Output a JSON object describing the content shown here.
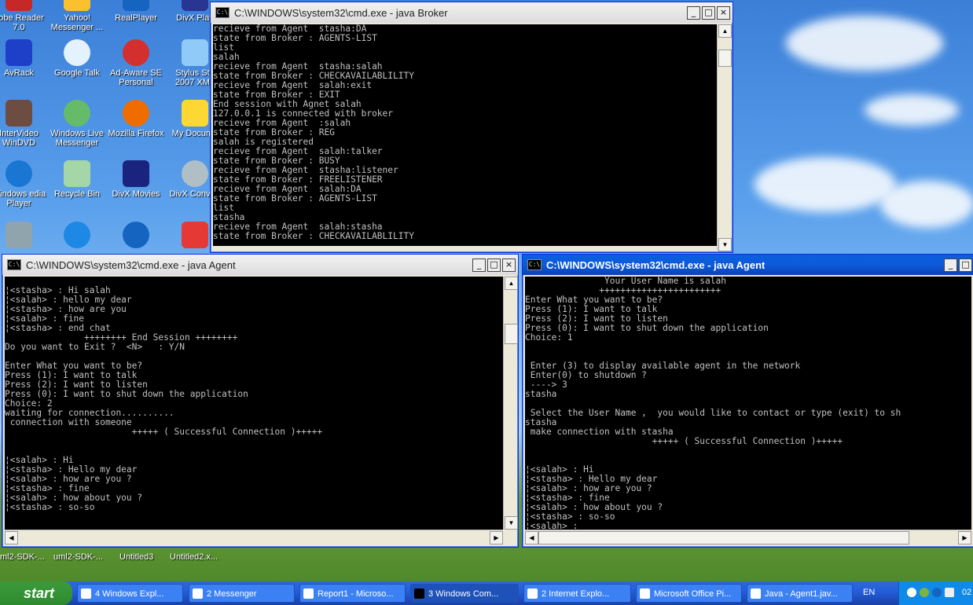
{
  "desktop": {
    "icons": [
      {
        "label": "dobe Reader 7.0"
      },
      {
        "label": "Yahoo! Messenger ..."
      },
      {
        "label": "RealPlayer"
      },
      {
        "label": "DivX Play"
      },
      {
        "label": "AvRack"
      },
      {
        "label": "Google Talk"
      },
      {
        "label": "Ad-Aware SE Personal"
      },
      {
        "label": "Stylus Stu 2007 XML"
      },
      {
        "label": "InterVideo WinDVD"
      },
      {
        "label": "Windows Live Messenger"
      },
      {
        "label": "Mozilla Firefox"
      },
      {
        "label": "My Docume"
      },
      {
        "label": "Windows edia Player"
      },
      {
        "label": "Recycle Bin"
      },
      {
        "label": "DivX Movies"
      },
      {
        "label": "DivX Convert"
      }
    ],
    "quicklaunch": [
      "ml2-SDK-...",
      "uml2-SDK-...",
      "Untitled3",
      "Untitled2.x..."
    ]
  },
  "windows": {
    "broker": {
      "title": "C:\\WINDOWS\\system32\\cmd.exe - java Broker",
      "lines": [
        "recieve from Agent  stasha:DA",
        "state from Broker : AGENTS-LIST",
        "list",
        "salah",
        "recieve from Agent  stasha:salah",
        "state from Broker : CHECKAVAILABLILITY",
        "recieve from Agent  salah:exit",
        "state from Broker : EXIT",
        "End session with Agnet salah",
        "127.0.0.1 is connected with broker",
        "recieve from Agent  :salah",
        "state from Broker : REG",
        "salah is registered",
        "recieve from Agent  salah:talker",
        "state from Broker : BUSY",
        "recieve from Agent  stasha:listener",
        "state from Broker : FREELISTENER",
        "recieve from Agent  salah:DA",
        "state from Broker : AGENTS-LIST",
        "list",
        "stasha",
        "recieve from Agent  salah:stasha",
        "state from Broker : CHECKAVAILABLILITY"
      ]
    },
    "agent_left": {
      "title": "C:\\WINDOWS\\system32\\cmd.exe - java Agent",
      "lines": [
        "",
        "¦<stasha> : Hi salah",
        "¦<salah> : hello my dear",
        "¦<stasha> : how are you",
        "¦<salah> : fine",
        "¦<stasha> : end chat",
        "               ++++++++ End Session ++++++++",
        "Do you want to Exit ?  <N>   : Y/N",
        "",
        "Enter What you want to be?",
        "Press (1): I want to talk",
        "Press (2): I want to listen",
        "Press (0): I want to shut down the application",
        "Choice: 2",
        "waiting for connection..........",
        " connection with someone",
        "                        +++++ ( Successful Connection )+++++",
        "",
        "",
        "¦<salah> : Hi",
        "¦<stasha> : Hello my dear",
        "¦<salah> : how are you ?",
        "¦<stasha> : fine",
        "¦<salah> : how about you ?",
        "¦<stasha> : so-so"
      ]
    },
    "agent_right": {
      "title": "C:\\WINDOWS\\system32\\cmd.exe - java Agent",
      "lines": [
        "               Your User Name is salah",
        "              +++++++++++++++++++++++",
        "Enter What you want to be?",
        "Press (1): I want to talk",
        "Press (2): I want to listen",
        "Press (0): I want to shut down the application",
        "Choice: 1",
        "",
        "",
        " Enter (3) to display available agent in the network",
        " Enter(0) to shutdown ?",
        " ----> 3",
        "stasha",
        "",
        " Select the User Name ,  you would like to contact or type (exit) to sh",
        "stasha",
        " make connection with stasha",
        "                        +++++ ( Successful Connection )+++++",
        "",
        "",
        "¦<salah> : Hi",
        "¦<stasha> : Hello my dear",
        "¦<salah> : how are you ?",
        "¦<stasha> : fine",
        "¦<salah> : how about you ?",
        "¦<stasha> : so-so",
        "¦<salah> :"
      ]
    }
  },
  "taskbar": {
    "start_label": "start",
    "tasks": [
      {
        "label": "4 Windows Expl..."
      },
      {
        "label": "2 Messenger"
      },
      {
        "label": "Report1 - Microso..."
      },
      {
        "label": "3 Windows Com..."
      },
      {
        "label": "2 Internet Explo..."
      },
      {
        "label": "Microsoft Office Pi..."
      },
      {
        "label": "Java - Agent1.jav..."
      }
    ],
    "language": "EN",
    "clock": "02"
  },
  "colors": {
    "console_bg": "#000000",
    "console_fg": "#c0c0c0",
    "titlebar_active": "#0a5fe0",
    "taskbar": "#245edb"
  }
}
